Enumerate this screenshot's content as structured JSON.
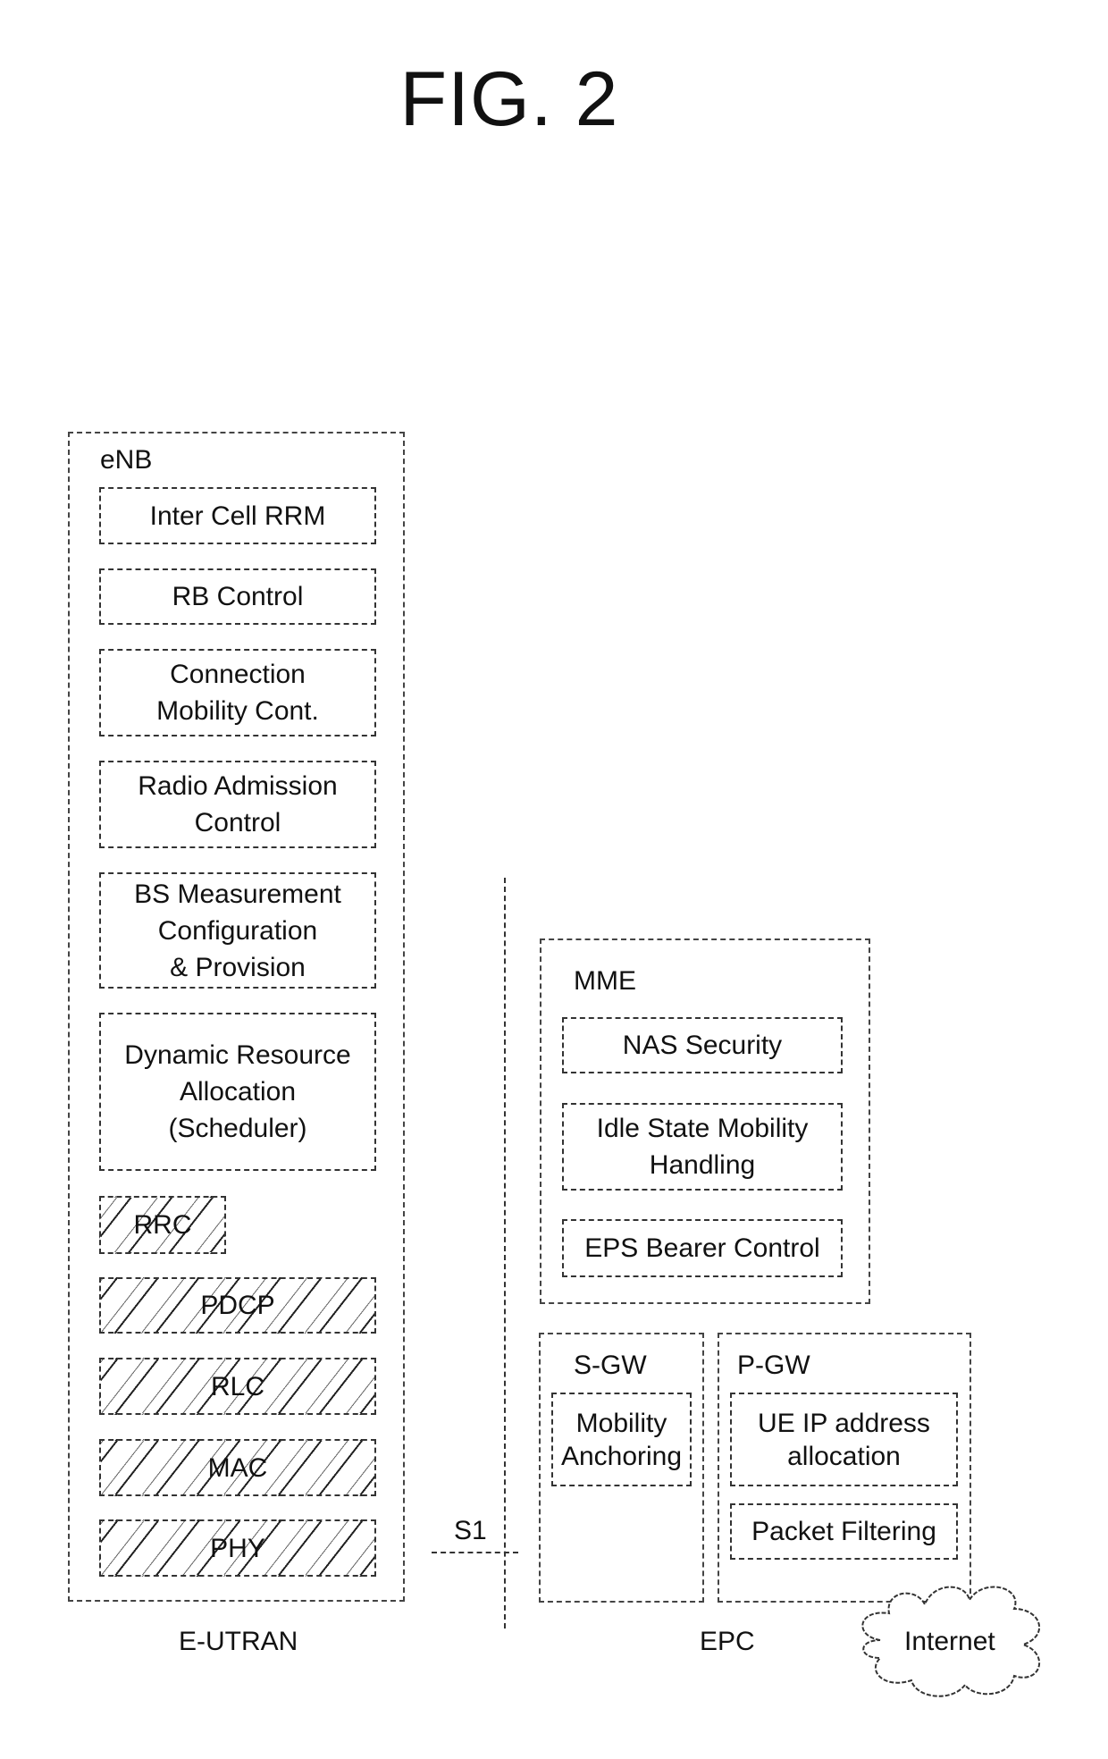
{
  "figure": {
    "title": "FIG. 2"
  },
  "enb": {
    "label": "eNB",
    "blocks": [
      {
        "text": "Inter Cell RRM",
        "hatched": false
      },
      {
        "text": "RB Control",
        "hatched": false
      },
      {
        "text": "Connection\nMobility Cont.",
        "hatched": false
      },
      {
        "text": "Radio Admission\nControl",
        "hatched": false
      },
      {
        "text": "BS Measurement\nConfiguration\n& Provision",
        "hatched": false
      },
      {
        "text": "Dynamic Resource\nAllocation\n(Scheduler)",
        "hatched": false
      },
      {
        "text": "RRC",
        "hatched": true
      },
      {
        "text": "PDCP",
        "hatched": true
      },
      {
        "text": "RLC",
        "hatched": true
      },
      {
        "text": "MAC",
        "hatched": true
      },
      {
        "text": "PHY",
        "hatched": true
      }
    ],
    "caption": "E-UTRAN"
  },
  "interface": {
    "label": "S1"
  },
  "mme": {
    "label": "MME",
    "blocks": [
      {
        "text": "NAS Security"
      },
      {
        "text": "Idle State Mobility\nHandling"
      },
      {
        "text": "EPS Bearer Control"
      }
    ]
  },
  "sgw": {
    "label": "S-GW",
    "blocks": [
      {
        "text": "Mobility\nAnchoring"
      }
    ]
  },
  "pgw": {
    "label": "P-GW",
    "blocks": [
      {
        "text": "UE IP address\nallocation"
      },
      {
        "text": "Packet Filtering"
      }
    ]
  },
  "epc": {
    "caption": "EPC"
  },
  "internet": {
    "label": "Internet"
  }
}
